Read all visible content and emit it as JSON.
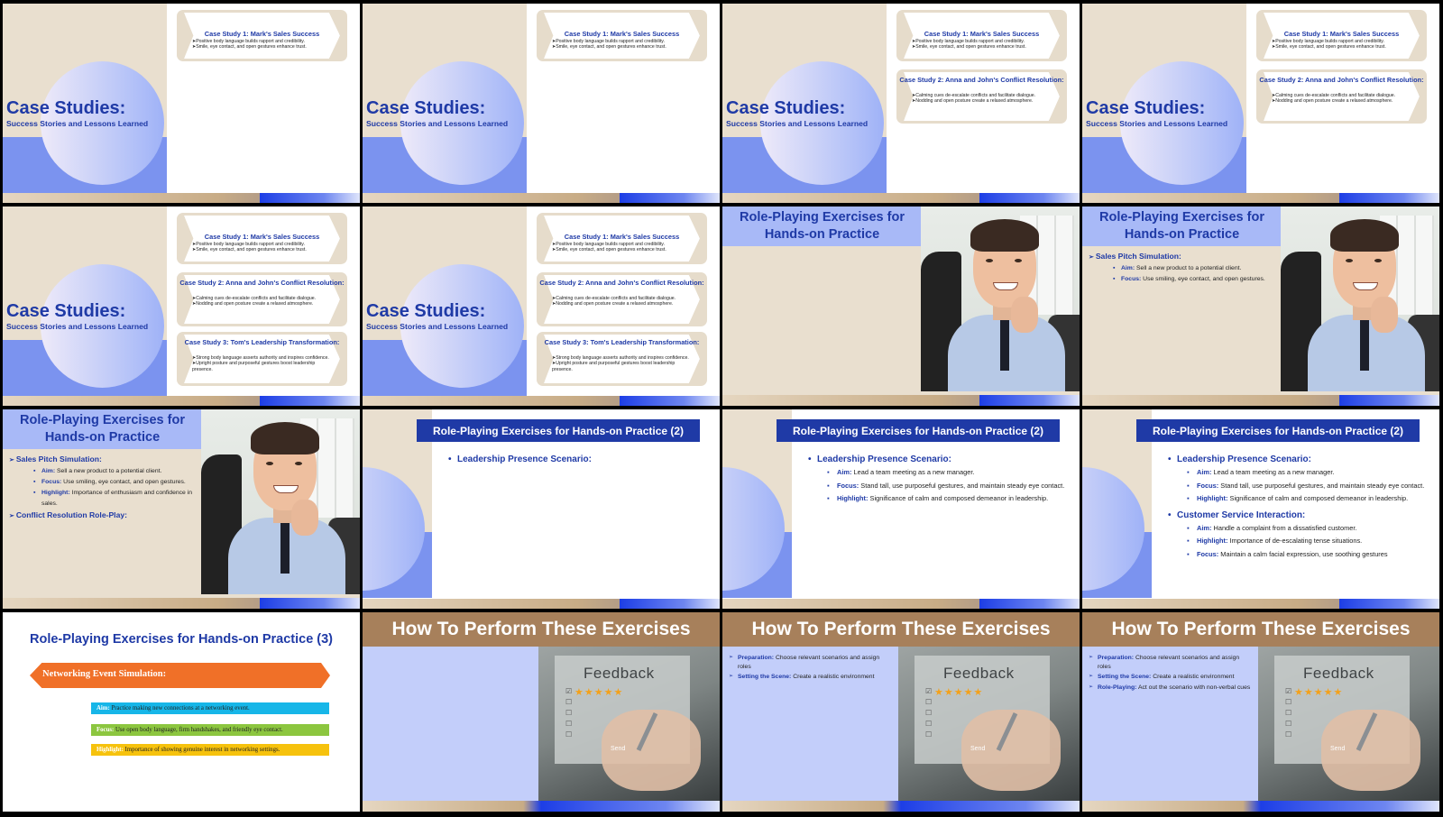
{
  "case_studies": {
    "title": "Case Studies:",
    "subtitle": "Success Stories and Lessons Learned",
    "case1": {
      "title": "Case Study 1: Mark's Sales Success",
      "points": [
        "Positive body language builds rapport and credibility.",
        "Smile, eye contact, and open gestures enhance trust."
      ]
    },
    "case2": {
      "title": "Case Study 2: Anna and John's Conflict Resolution:",
      "points": [
        "Calming cues de-escalate conflicts and facilitate dialogue.",
        "Nodding and open posture create a relaxed atmosphere."
      ]
    },
    "case3": {
      "title": "Case Study 3: Tom's Leadership Transformation:",
      "points": [
        "Strong body language asserts authority and inspires confidence.",
        "Upright posture and purposeful gestures boost leadership presence."
      ]
    }
  },
  "role_play": {
    "title": "Role-Playing Exercises for Hands-on Practice",
    "sales": {
      "heading": "Sales Pitch Simulation:",
      "aim_label": "Aim:",
      "aim": "Sell a new product to a potential client.",
      "focus_label": "Focus:",
      "focus": "Use smiling, eye contact, and open gestures.",
      "highlight_label": "Highlight:",
      "highlight": "Importance of enthusiasm and confidence in sales."
    },
    "conflict_heading": "Conflict Resolution Role-Play:"
  },
  "role_play2": {
    "title": "Role-Playing Exercises for Hands-on Practice (2)",
    "leadership": {
      "heading": "Leadership Presence Scenario:",
      "aim_label": "Aim:",
      "aim": "Lead a team meeting as a new manager.",
      "focus_label": "Focus:",
      "focus": "Stand tall, use purposeful gestures, and maintain steady eye contact.",
      "highlight_label": "Highlight:",
      "highlight": "Significance of calm and composed demeanor in leadership."
    },
    "customer": {
      "heading": "Customer Service Interaction:",
      "aim_label": "Aim:",
      "aim": "Handle a complaint from a dissatisfied customer.",
      "highlight_label": "Highlight:",
      "highlight": "Importance of de-escalating tense situations.",
      "focus_label": "Focus:",
      "focus": "Maintain a calm facial expression, use soothing gestures"
    }
  },
  "role_play3": {
    "title": "Role-Playing Exercises for Hands-on Practice (3)",
    "arrow": "Networking Event Simulation:",
    "aim_label": "Aim:",
    "aim": "Practice making new connections at a networking event.",
    "focus_label": "Focus:",
    "focus": "Use open body language, firm handshakes, and friendly eye contact.",
    "highlight_label": "Highlight:",
    "highlight": "Importance of showing genuine interest in networking settings."
  },
  "how_to": {
    "title": "How To Perform These Exercises",
    "image_text": "Feedback",
    "image_send": "Send",
    "prep_label": "Preparation:",
    "prep": "Choose relevant scenarios and assign roles",
    "scene_label": "Setting the Scene:",
    "scene": "Create a realistic environment",
    "role_label": "Role-Playing:",
    "role": "Act out the scenario with non-verbal cues"
  },
  "colors": {
    "navy": "#1f3aa6",
    "beige": "#e9dfcf",
    "periwinkle": "#7b93ef",
    "light_blue": "#c3cefa",
    "brown": "#a7805b",
    "orange": "#f07028"
  }
}
